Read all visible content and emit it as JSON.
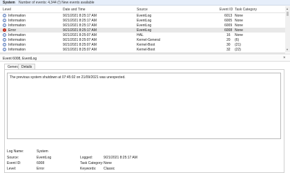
{
  "topbar": {
    "title": "System",
    "subtitle": "Number of events: 4,344 (!) New events available"
  },
  "columns": {
    "level": "Level",
    "date": "Date and Time",
    "source": "Source",
    "event_id": "Event ID",
    "task": "Task Category"
  },
  "rows": [
    {
      "level": "Information",
      "date": "9/21/2021 8:25:17 AM",
      "source": "EventLog",
      "event_id": "6013",
      "task": "None",
      "icon": "info-icon"
    },
    {
      "level": "Information",
      "date": "9/21/2021 8:25:17 AM",
      "source": "EventLog",
      "event_id": "6005",
      "task": "None",
      "icon": "info-icon"
    },
    {
      "level": "Information",
      "date": "9/21/2021 8:25:17 AM",
      "source": "EventLog",
      "event_id": "6009",
      "task": "None",
      "icon": "info-icon"
    },
    {
      "level": "Error",
      "date": "9/21/2021 8:25:17 AM",
      "source": "EventLog",
      "event_id": "6008",
      "task": "None",
      "icon": "error-icon"
    },
    {
      "level": "Information",
      "date": "9/21/2021 8:25:07 AM",
      "source": "HAL",
      "event_id": "16",
      "task": "None",
      "icon": "info-icon"
    },
    {
      "level": "Information",
      "date": "9/21/2021 8:25:07 AM",
      "source": "Kernel-General",
      "event_id": "20",
      "task": "(6)",
      "icon": "info-icon"
    },
    {
      "level": "Information",
      "date": "9/21/2021 8:25:07 AM",
      "source": "Kernel-Boot",
      "event_id": "30",
      "task": "(21)",
      "icon": "info-icon"
    },
    {
      "level": "Information",
      "date": "9/21/2021 8:25:07 AM",
      "source": "Kernel-Boot",
      "event_id": "32",
      "task": "(22)",
      "icon": "info-icon"
    }
  ],
  "detail": {
    "header": "Event 6008, EventLog",
    "tabs": [
      "General",
      "Details"
    ],
    "message": "The previous system shutdown at 07:45:02 on 21/09/2021 was unexpected.",
    "fields": {
      "log_name_label": "Log Name:",
      "log_name": "System",
      "source_label": "Source:",
      "source": "EventLog",
      "logged_label": "Logged:",
      "logged": "9/21/2021 8:25:17 AM",
      "event_id_label": "Event ID:",
      "event_id": "6008",
      "task_label": "Task Category:",
      "task": "None",
      "level_label": "Level:",
      "level": "Error",
      "keywords_label": "Keywords:",
      "keywords": "Classic"
    }
  }
}
